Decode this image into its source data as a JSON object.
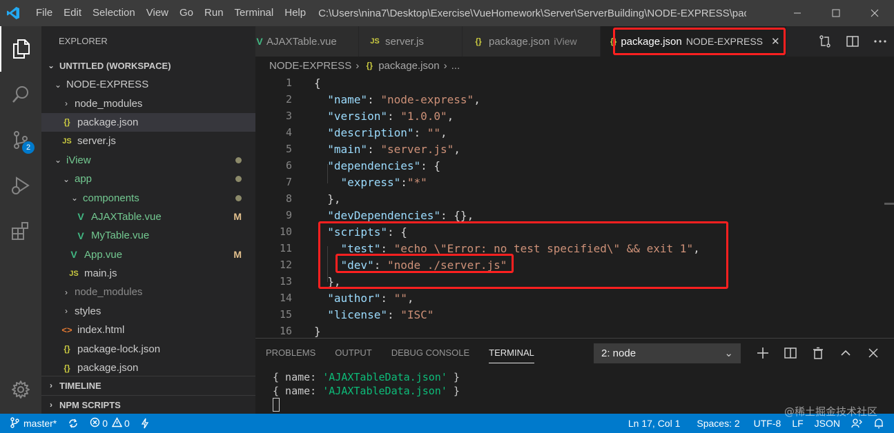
{
  "titlebar": {
    "menu": [
      "File",
      "Edit",
      "Selection",
      "View",
      "Go",
      "Run",
      "Terminal",
      "Help"
    ],
    "window_title": "C:\\Users\\nina7\\Desktop\\Exercise\\VueHomework\\Server\\ServerBuilding\\NODE-EXPRESS\\pac..."
  },
  "activitybar": {
    "scm_badge": "2"
  },
  "sidebar": {
    "title": "EXPLORER",
    "workspace": "UNTITLED (WORKSPACE)",
    "tree": [
      {
        "label": "NODE-EXPRESS",
        "type": "folder-open"
      },
      {
        "label": "node_modules",
        "type": "folder"
      },
      {
        "label": "package.json",
        "type": "json",
        "selected": true
      },
      {
        "label": "server.js",
        "type": "js"
      },
      {
        "label": "iView",
        "type": "folder-open",
        "dot": true
      },
      {
        "label": "app",
        "type": "folder-open",
        "dot": true
      },
      {
        "label": "components",
        "type": "folder-open",
        "dot": true
      },
      {
        "label": "AJAXTable.vue",
        "type": "vue",
        "status": "M"
      },
      {
        "label": "MyTable.vue",
        "type": "vue"
      },
      {
        "label": "App.vue",
        "type": "vue",
        "status": "M"
      },
      {
        "label": "main.js",
        "type": "js"
      },
      {
        "label": "node_modules",
        "type": "folder"
      },
      {
        "label": "styles",
        "type": "folder"
      },
      {
        "label": "index.html",
        "type": "html"
      },
      {
        "label": "package-lock.json",
        "type": "json"
      },
      {
        "label": "package.json",
        "type": "json"
      }
    ],
    "timeline": "TIMELINE",
    "npm_scripts": "NPM SCRIPTS"
  },
  "tabs": [
    {
      "label": "AJAXTable.vue",
      "icon": "V",
      "desc": ""
    },
    {
      "label": "server.js",
      "icon": "JS",
      "desc": ""
    },
    {
      "label": "package.json",
      "icon": "{}",
      "desc": "iView"
    },
    {
      "label": "package.json",
      "icon": "{}",
      "desc": "NODE-EXPRESS",
      "active": true
    }
  ],
  "breadcrumb": {
    "folder": "NODE-EXPRESS",
    "file": "package.json",
    "rest": "..."
  },
  "code": {
    "line_numbers": [
      "1",
      "2",
      "3",
      "4",
      "5",
      "6",
      "7",
      "8",
      "9",
      "10",
      "11",
      "12",
      "13",
      "14",
      "15",
      "16"
    ]
  },
  "panel": {
    "tabs": [
      "PROBLEMS",
      "OUTPUT",
      "DEBUG CONSOLE",
      "TERMINAL"
    ],
    "active_tab": "TERMINAL",
    "terminal_select": "2: node",
    "terminal_lines": [
      {
        "prefix": "{ name: ",
        "value": "'AJAXTableData.json'",
        "suffix": " }"
      },
      {
        "prefix": "{ name: ",
        "value": "'AJAXTableData.json'",
        "suffix": " }"
      }
    ]
  },
  "statusbar": {
    "branch": "master*",
    "errors": "0",
    "warnings": "0",
    "position": "Ln 17, Col 1",
    "spaces": "Spaces: 2",
    "encoding": "UTF-8",
    "eol": "LF",
    "language": "JSON"
  },
  "watermark": "@稀土掘金技术社区",
  "colors": {
    "accent": "#007acc",
    "highlight_box": "#ff2020",
    "json_key": "#9cdcfe",
    "json_string": "#ce9178",
    "modified": "#e2c08d",
    "git_added": "#73c991"
  }
}
